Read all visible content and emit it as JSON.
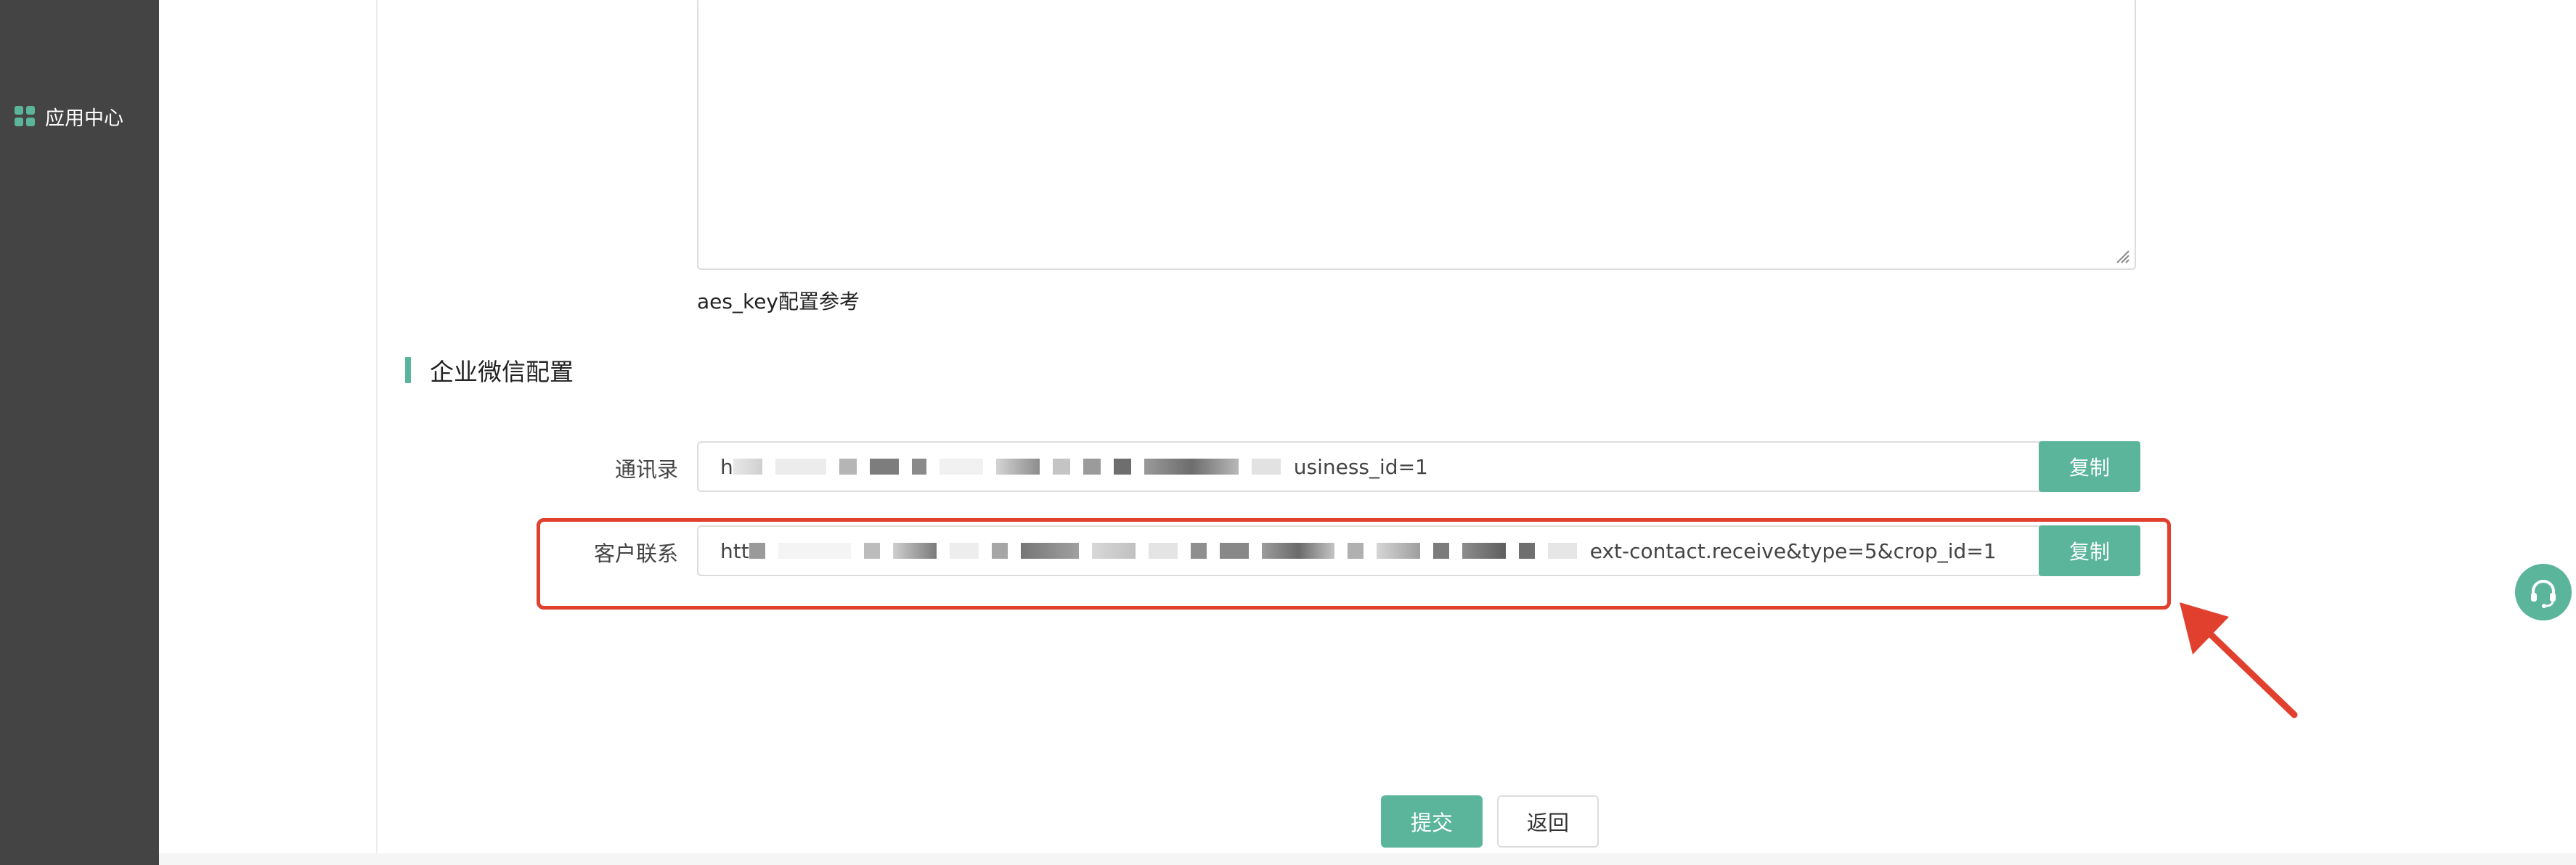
{
  "sidebar": {
    "items": [
      {
        "label": "应用中心",
        "icon": "apps-grid-icon"
      }
    ]
  },
  "aes_section": {
    "hint": "aes_key配置参考"
  },
  "wecom_section": {
    "title": "企业微信配置",
    "rows": [
      {
        "label": "通讯录",
        "value_prefix": "h",
        "value_suffix": "usiness_id=1",
        "copy_label": "复制"
      },
      {
        "label": "客户联系",
        "value_prefix": "htt",
        "value_suffix": "ext-contact.receive&type=5&crop_id=1",
        "copy_label": "复制"
      }
    ]
  },
  "actions": {
    "submit_label": "提交",
    "back_label": "返回"
  },
  "floating": {
    "support_icon": "headset-icon"
  },
  "colors": {
    "accent": "#5ab59a",
    "sidebar_bg": "#444444",
    "highlight": "#e2402e"
  }
}
